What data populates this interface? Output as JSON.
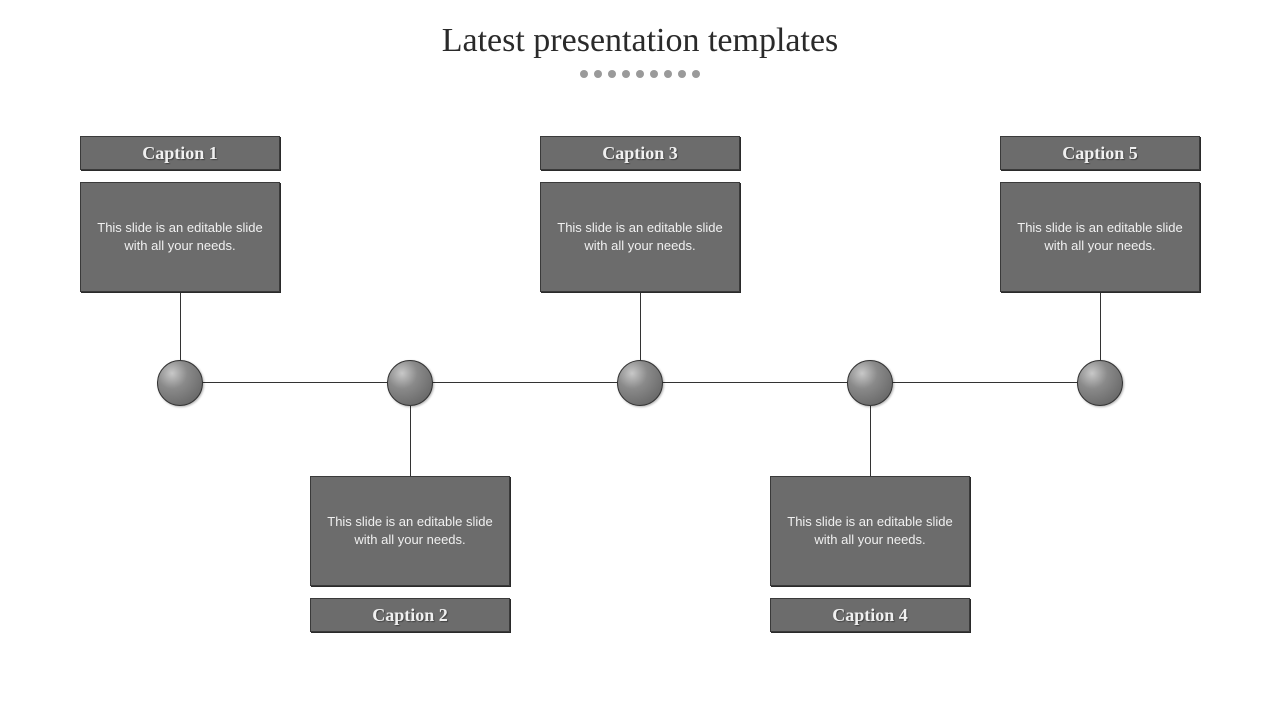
{
  "title": "Latest presentation templates",
  "dot_count": 9,
  "nodes": [
    {
      "caption": "Caption 1",
      "desc": "This slide is an editable slide with all your needs."
    },
    {
      "caption": "Caption 2",
      "desc": "This slide is an editable slide with all your needs."
    },
    {
      "caption": "Caption 3",
      "desc": "This slide is an editable slide with all your needs."
    },
    {
      "caption": "Caption 4",
      "desc": "This slide is an editable slide with all your needs."
    },
    {
      "caption": "Caption 5",
      "desc": "This slide is an editable slide with all your needs."
    }
  ],
  "chart_data": {
    "type": "diagram",
    "title": "Latest presentation templates",
    "layout": "horizontal-timeline",
    "node_count": 5,
    "nodes": [
      {
        "index": 1,
        "caption": "Caption 1",
        "position": "above",
        "desc": "This slide is an editable slide with all your needs."
      },
      {
        "index": 2,
        "caption": "Caption 2",
        "position": "below",
        "desc": "This slide is an editable slide with all your needs."
      },
      {
        "index": 3,
        "caption": "Caption 3",
        "position": "above",
        "desc": "This slide is an editable slide with all your needs."
      },
      {
        "index": 4,
        "caption": "Caption 4",
        "position": "below",
        "desc": "This slide is an editable slide with all your needs."
      },
      {
        "index": 5,
        "caption": "Caption 5",
        "position": "above",
        "desc": "This slide is an editable slide with all your needs."
      }
    ]
  }
}
